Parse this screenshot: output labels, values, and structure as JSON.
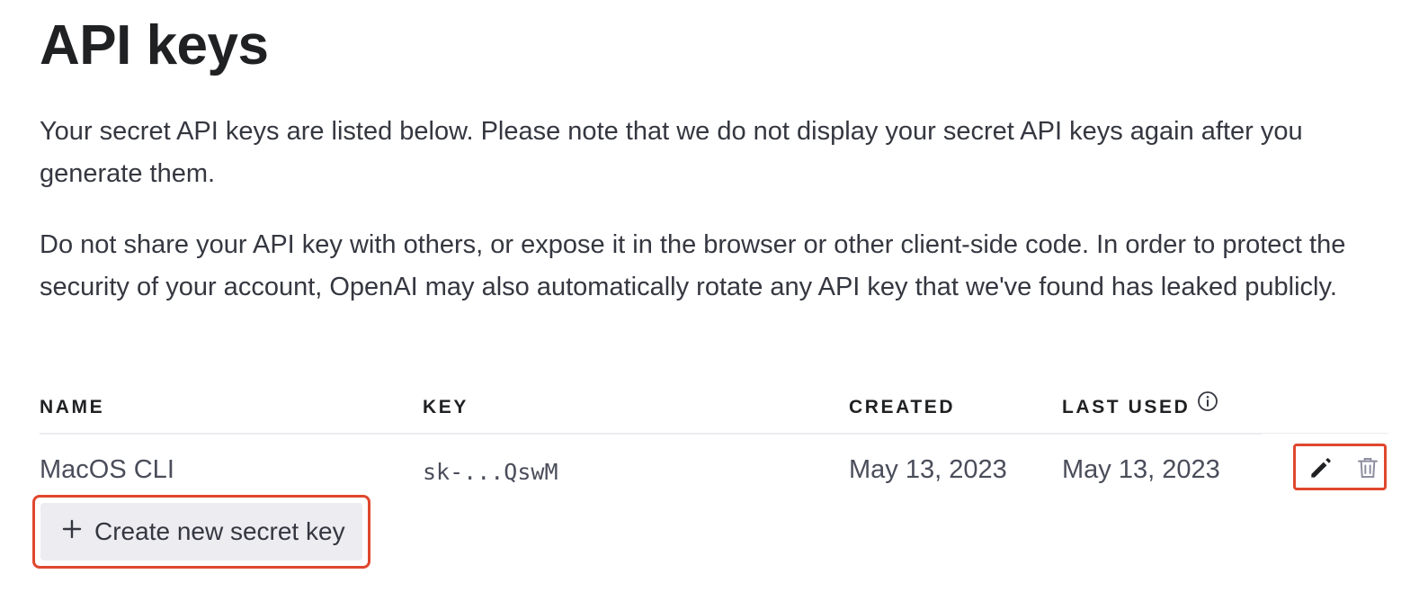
{
  "page": {
    "title": "API keys",
    "paragraphs": [
      "Your secret API keys are listed below. Please note that we do not display your secret API keys again after you generate them.",
      "Do not share your API key with others, or expose it in the browser or other client-side code. In order to protect the security of your account, OpenAI may also automatically rotate any API key that we've found has leaked publicly."
    ]
  },
  "table": {
    "headers": {
      "name": "NAME",
      "key": "KEY",
      "created": "CREATED",
      "last_used": "LAST USED"
    },
    "header_icons": {
      "last_used": "info-icon"
    },
    "rows": [
      {
        "name": "MacOS CLI",
        "key": "sk-...QswM",
        "created": "May 13, 2023",
        "last_used": "May 13, 2023",
        "actions": [
          "edit-icon",
          "trash-icon"
        ]
      }
    ]
  },
  "create_button": {
    "label": "Create new secret key",
    "icon": "plus-icon"
  },
  "colors": {
    "text_primary": "#202123",
    "text_secondary": "#353740",
    "text_cell": "#4a4d5a",
    "button_bg": "#ececf1",
    "highlight": "#e0472e",
    "divider": "#ececf1"
  }
}
